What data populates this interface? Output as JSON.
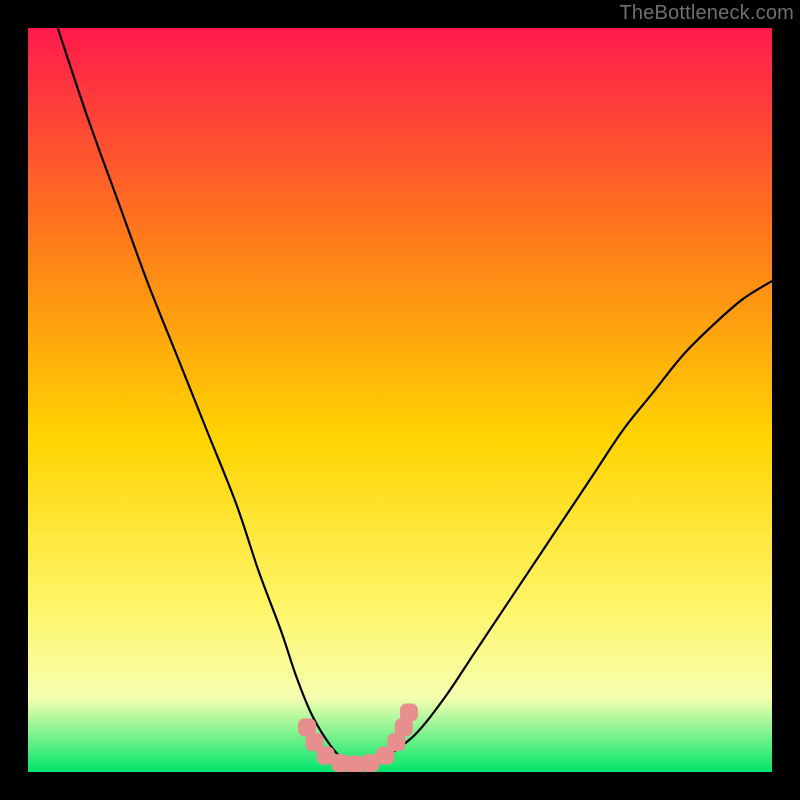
{
  "watermark": "TheBottleneck.com",
  "colors": {
    "frame": "#000000",
    "gradient_top": "#ff1a4d",
    "gradient_mid_upper": "#ff7a1a",
    "gradient_mid": "#ffd400",
    "gradient_low": "#fff66a",
    "gradient_pale": "#f6ffb0",
    "gradient_bottom": "#00e56a",
    "curve": "#000000",
    "marker": "#e78f8f"
  },
  "chart_data": {
    "type": "line",
    "title": "",
    "xlabel": "",
    "ylabel": "",
    "xlim": [
      0,
      100
    ],
    "ylim": [
      0,
      100
    ],
    "series": [
      {
        "name": "bottleneck-curve",
        "x": [
          4,
          8,
          12,
          16,
          20,
          24,
          28,
          31,
          34,
          36,
          38,
          40,
          42,
          44,
          46,
          48,
          52,
          56,
          60,
          64,
          68,
          72,
          76,
          80,
          84,
          88,
          92,
          96,
          100
        ],
        "y": [
          100,
          88,
          77,
          66,
          56,
          46,
          36,
          27,
          19,
          13,
          8,
          4.5,
          2,
          1,
          1,
          2,
          5,
          10,
          16,
          22,
          28,
          34,
          40,
          46,
          51,
          56,
          60,
          63.5,
          66
        ]
      }
    ],
    "markers": {
      "name": "flat-bottom-markers",
      "points": [
        {
          "x": 37.5,
          "y": 6
        },
        {
          "x": 38.5,
          "y": 4
        },
        {
          "x": 40,
          "y": 2.2
        },
        {
          "x": 42,
          "y": 1.2
        },
        {
          "x": 44,
          "y": 1.0
        },
        {
          "x": 46,
          "y": 1.2
        },
        {
          "x": 48,
          "y": 2.2
        },
        {
          "x": 49.5,
          "y": 4
        },
        {
          "x": 50.5,
          "y": 6
        },
        {
          "x": 51.2,
          "y": 8
        }
      ]
    },
    "background_gradient_stops": [
      {
        "pct": 0,
        "color": "#ff1a4d"
      },
      {
        "pct": 28,
        "color": "#ff7a1a"
      },
      {
        "pct": 55,
        "color": "#ffd400"
      },
      {
        "pct": 78,
        "color": "#fff66a"
      },
      {
        "pct": 90,
        "color": "#f6ffb0"
      },
      {
        "pct": 100,
        "color": "#00e56a"
      }
    ]
  }
}
